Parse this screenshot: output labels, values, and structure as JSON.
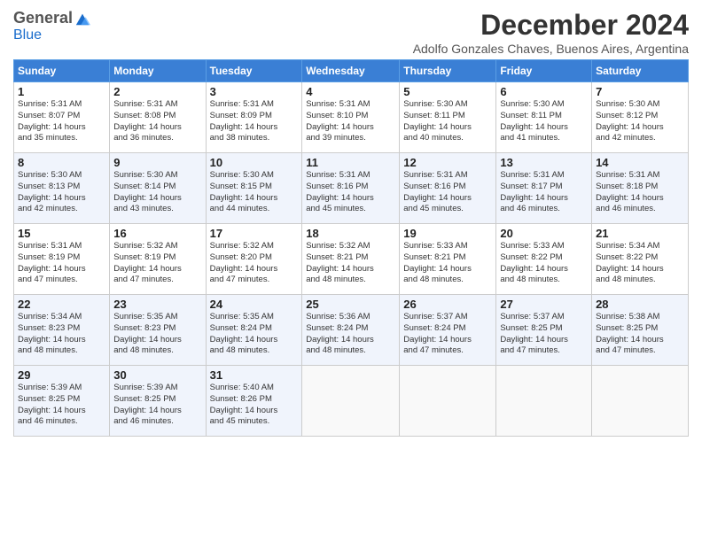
{
  "logo": {
    "general": "General",
    "blue": "Blue"
  },
  "header": {
    "month": "December 2024",
    "location": "Adolfo Gonzales Chaves, Buenos Aires, Argentina"
  },
  "weekdays": [
    "Sunday",
    "Monday",
    "Tuesday",
    "Wednesday",
    "Thursday",
    "Friday",
    "Saturday"
  ],
  "rows": [
    [
      {
        "day": "1",
        "lines": [
          "Sunrise: 5:31 AM",
          "Sunset: 8:07 PM",
          "Daylight: 14 hours",
          "and 35 minutes."
        ]
      },
      {
        "day": "2",
        "lines": [
          "Sunrise: 5:31 AM",
          "Sunset: 8:08 PM",
          "Daylight: 14 hours",
          "and 36 minutes."
        ]
      },
      {
        "day": "3",
        "lines": [
          "Sunrise: 5:31 AM",
          "Sunset: 8:09 PM",
          "Daylight: 14 hours",
          "and 38 minutes."
        ]
      },
      {
        "day": "4",
        "lines": [
          "Sunrise: 5:31 AM",
          "Sunset: 8:10 PM",
          "Daylight: 14 hours",
          "and 39 minutes."
        ]
      },
      {
        "day": "5",
        "lines": [
          "Sunrise: 5:30 AM",
          "Sunset: 8:11 PM",
          "Daylight: 14 hours",
          "and 40 minutes."
        ]
      },
      {
        "day": "6",
        "lines": [
          "Sunrise: 5:30 AM",
          "Sunset: 8:11 PM",
          "Daylight: 14 hours",
          "and 41 minutes."
        ]
      },
      {
        "day": "7",
        "lines": [
          "Sunrise: 5:30 AM",
          "Sunset: 8:12 PM",
          "Daylight: 14 hours",
          "and 42 minutes."
        ]
      }
    ],
    [
      {
        "day": "8",
        "lines": [
          "Sunrise: 5:30 AM",
          "Sunset: 8:13 PM",
          "Daylight: 14 hours",
          "and 42 minutes."
        ]
      },
      {
        "day": "9",
        "lines": [
          "Sunrise: 5:30 AM",
          "Sunset: 8:14 PM",
          "Daylight: 14 hours",
          "and 43 minutes."
        ]
      },
      {
        "day": "10",
        "lines": [
          "Sunrise: 5:30 AM",
          "Sunset: 8:15 PM",
          "Daylight: 14 hours",
          "and 44 minutes."
        ]
      },
      {
        "day": "11",
        "lines": [
          "Sunrise: 5:31 AM",
          "Sunset: 8:16 PM",
          "Daylight: 14 hours",
          "and 45 minutes."
        ]
      },
      {
        "day": "12",
        "lines": [
          "Sunrise: 5:31 AM",
          "Sunset: 8:16 PM",
          "Daylight: 14 hours",
          "and 45 minutes."
        ]
      },
      {
        "day": "13",
        "lines": [
          "Sunrise: 5:31 AM",
          "Sunset: 8:17 PM",
          "Daylight: 14 hours",
          "and 46 minutes."
        ]
      },
      {
        "day": "14",
        "lines": [
          "Sunrise: 5:31 AM",
          "Sunset: 8:18 PM",
          "Daylight: 14 hours",
          "and 46 minutes."
        ]
      }
    ],
    [
      {
        "day": "15",
        "lines": [
          "Sunrise: 5:31 AM",
          "Sunset: 8:19 PM",
          "Daylight: 14 hours",
          "and 47 minutes."
        ]
      },
      {
        "day": "16",
        "lines": [
          "Sunrise: 5:32 AM",
          "Sunset: 8:19 PM",
          "Daylight: 14 hours",
          "and 47 minutes."
        ]
      },
      {
        "day": "17",
        "lines": [
          "Sunrise: 5:32 AM",
          "Sunset: 8:20 PM",
          "Daylight: 14 hours",
          "and 47 minutes."
        ]
      },
      {
        "day": "18",
        "lines": [
          "Sunrise: 5:32 AM",
          "Sunset: 8:21 PM",
          "Daylight: 14 hours",
          "and 48 minutes."
        ]
      },
      {
        "day": "19",
        "lines": [
          "Sunrise: 5:33 AM",
          "Sunset: 8:21 PM",
          "Daylight: 14 hours",
          "and 48 minutes."
        ]
      },
      {
        "day": "20",
        "lines": [
          "Sunrise: 5:33 AM",
          "Sunset: 8:22 PM",
          "Daylight: 14 hours",
          "and 48 minutes."
        ]
      },
      {
        "day": "21",
        "lines": [
          "Sunrise: 5:34 AM",
          "Sunset: 8:22 PM",
          "Daylight: 14 hours",
          "and 48 minutes."
        ]
      }
    ],
    [
      {
        "day": "22",
        "lines": [
          "Sunrise: 5:34 AM",
          "Sunset: 8:23 PM",
          "Daylight: 14 hours",
          "and 48 minutes."
        ]
      },
      {
        "day": "23",
        "lines": [
          "Sunrise: 5:35 AM",
          "Sunset: 8:23 PM",
          "Daylight: 14 hours",
          "and 48 minutes."
        ]
      },
      {
        "day": "24",
        "lines": [
          "Sunrise: 5:35 AM",
          "Sunset: 8:24 PM",
          "Daylight: 14 hours",
          "and 48 minutes."
        ]
      },
      {
        "day": "25",
        "lines": [
          "Sunrise: 5:36 AM",
          "Sunset: 8:24 PM",
          "Daylight: 14 hours",
          "and 48 minutes."
        ]
      },
      {
        "day": "26",
        "lines": [
          "Sunrise: 5:37 AM",
          "Sunset: 8:24 PM",
          "Daylight: 14 hours",
          "and 47 minutes."
        ]
      },
      {
        "day": "27",
        "lines": [
          "Sunrise: 5:37 AM",
          "Sunset: 8:25 PM",
          "Daylight: 14 hours",
          "and 47 minutes."
        ]
      },
      {
        "day": "28",
        "lines": [
          "Sunrise: 5:38 AM",
          "Sunset: 8:25 PM",
          "Daylight: 14 hours",
          "and 47 minutes."
        ]
      }
    ],
    [
      {
        "day": "29",
        "lines": [
          "Sunrise: 5:39 AM",
          "Sunset: 8:25 PM",
          "Daylight: 14 hours",
          "and 46 minutes."
        ]
      },
      {
        "day": "30",
        "lines": [
          "Sunrise: 5:39 AM",
          "Sunset: 8:25 PM",
          "Daylight: 14 hours",
          "and 46 minutes."
        ]
      },
      {
        "day": "31",
        "lines": [
          "Sunrise: 5:40 AM",
          "Sunset: 8:26 PM",
          "Daylight: 14 hours",
          "and 45 minutes."
        ]
      },
      {
        "day": "",
        "lines": []
      },
      {
        "day": "",
        "lines": []
      },
      {
        "day": "",
        "lines": []
      },
      {
        "day": "",
        "lines": []
      }
    ]
  ]
}
